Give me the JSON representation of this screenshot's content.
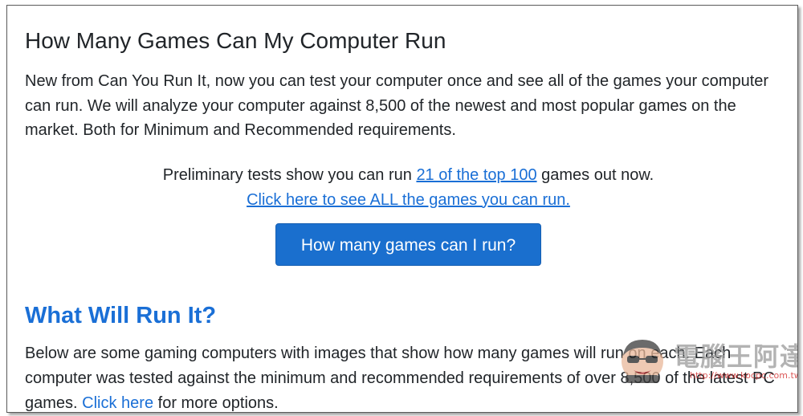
{
  "page": {
    "title": "How Many Games Can My Computer Run",
    "intro": "New from Can You Run It, now you can test your computer once and see all of the games your computer can run. We will analyze your computer against 8,500 of the newest and most popular games on the market. Both for Minimum and Recommended requirements.",
    "prelim_before": "Preliminary tests show you can run ",
    "prelim_link": "21 of the top 100",
    "prelim_after": " games out now.",
    "all_games_link": "Click here to see ALL the games you can run.",
    "cta_button": "How many games can I run?"
  },
  "section": {
    "heading": "What Will Run It?",
    "body_before": "Below are some gaming computers with images that show how many games will run on each. Each computer was tested against the minimum and recommended requirements of over 8,500 of the latest PC games. ",
    "body_link": "Click here",
    "body_after": " for more options."
  },
  "watermark": {
    "text": "電腦王阿達",
    "url": "http://www.kocpc.com.tw",
    "icon": "mascot-face-icon"
  },
  "colors": {
    "link": "#1a6fd6",
    "button": "#1a6fce",
    "text": "#212529"
  }
}
